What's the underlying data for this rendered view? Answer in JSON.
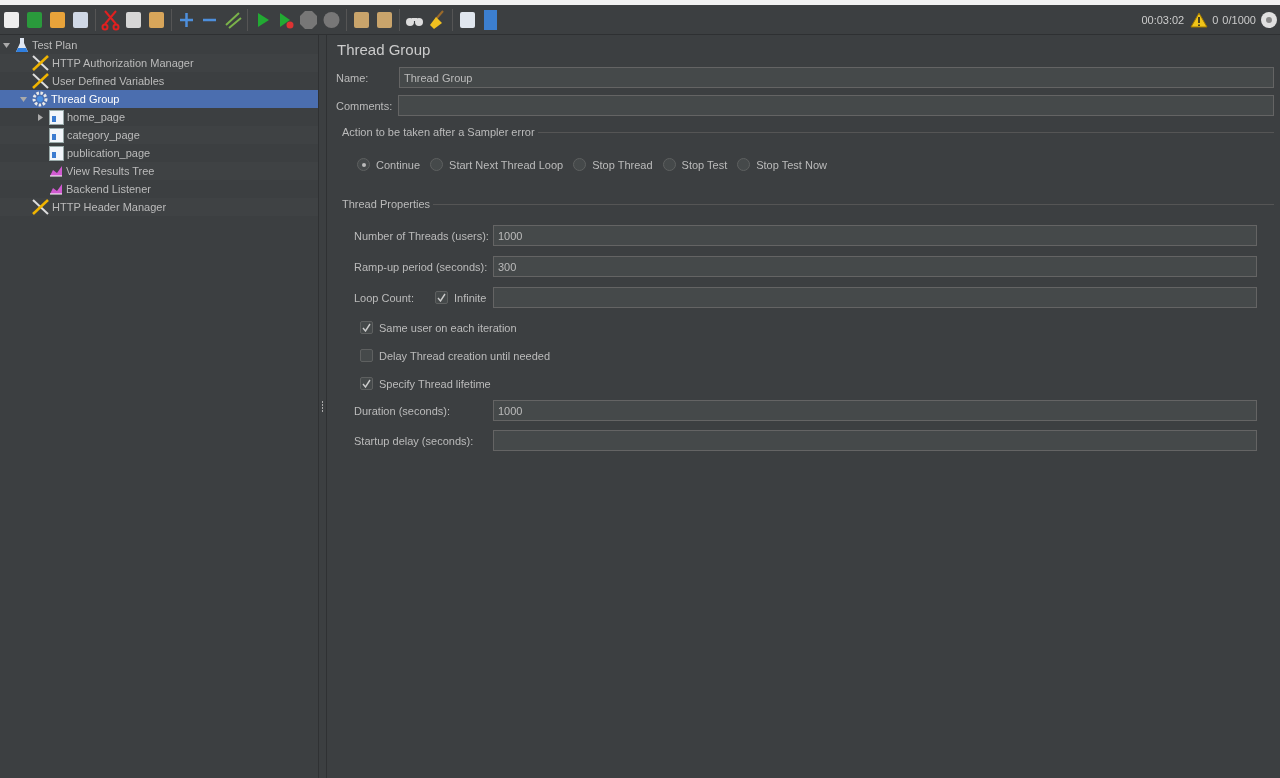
{
  "status": {
    "elapsed": "00:03:02",
    "warnings": "0",
    "threads": "0/1000"
  },
  "tree": [
    {
      "label": "Test Plan",
      "kind": "plan",
      "selected": false,
      "expanded": true,
      "children": [
        {
          "label": "HTTP Authorization Manager",
          "kind": "tool",
          "selected": false
        },
        {
          "label": "User Defined Variables",
          "kind": "tool",
          "selected": false
        },
        {
          "label": "Thread Group",
          "kind": "gear",
          "selected": true,
          "expanded": true,
          "children": [
            {
              "label": "home_page",
              "kind": "sampler",
              "selected": false,
              "expanded": false
            },
            {
              "label": "category_page",
              "kind": "sampler",
              "selected": false
            },
            {
              "label": "publication_page",
              "kind": "sampler",
              "selected": false
            },
            {
              "label": "View Results Tree",
              "kind": "listener",
              "selected": false
            },
            {
              "label": "Backend Listener",
              "kind": "listener",
              "selected": false
            }
          ]
        },
        {
          "label": "HTTP Header Manager",
          "kind": "tool",
          "selected": false
        }
      ]
    }
  ],
  "panel": {
    "title": "Thread Group",
    "name_label": "Name:",
    "name_value": "Thread Group",
    "comments_label": "Comments:",
    "error_action": {
      "legend": "Action to be taken after a Sampler error",
      "options": [
        {
          "label": "Continue",
          "selected": true
        },
        {
          "label": "Start Next Thread Loop",
          "selected": false
        },
        {
          "label": "Stop Thread",
          "selected": false
        },
        {
          "label": "Stop Test",
          "selected": false
        },
        {
          "label": "Stop Test Now",
          "selected": false
        }
      ]
    },
    "properties": {
      "legend": "Thread Properties",
      "threads_label": "Number of Threads (users):",
      "threads_value": "1000",
      "rampup_label": "Ramp-up period (seconds):",
      "rampup_value": "300",
      "loop_label": "Loop Count:",
      "infinite": {
        "label": "Infinite",
        "checked": true
      },
      "options": [
        {
          "label": "Same user on each iteration",
          "checked": true
        },
        {
          "label": "Delay Thread creation until needed",
          "checked": false
        },
        {
          "label": "Specify Thread lifetime",
          "checked": true
        }
      ],
      "duration_label": "Duration (seconds):",
      "duration_value": "1000",
      "startup_label": "Startup delay (seconds):"
    }
  }
}
